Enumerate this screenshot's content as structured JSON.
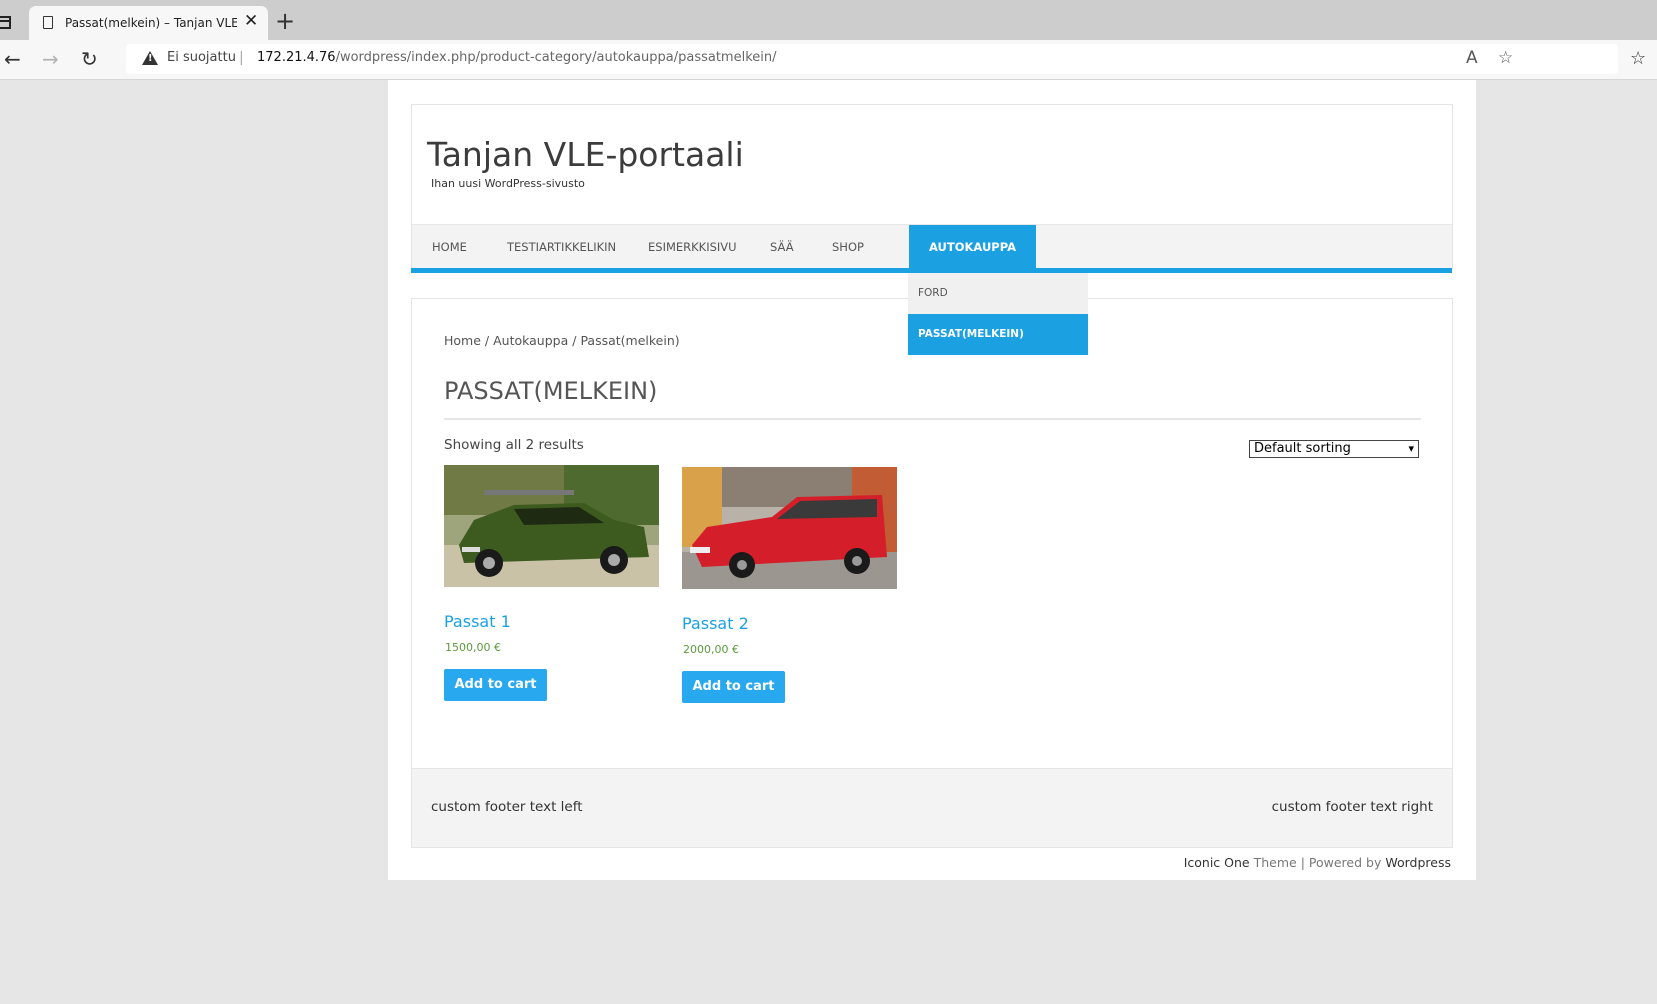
{
  "browser": {
    "tab_title": "Passat(melkein) – Tanjan VLE-portaali",
    "security_label": "Ei suojattu",
    "url_host": "172.21.4.76",
    "url_path": "/wordpress/index.php/product-category/autokauppa/passatmelkein/"
  },
  "site": {
    "title": "Tanjan VLE-portaali",
    "description": "Ihan uusi WordPress-sivusto"
  },
  "menu": {
    "items": [
      "HOME",
      "TESTIARTIKKELIKIN",
      "ESIMERKKISIVU",
      "SÄÄ",
      "SHOP",
      "AUTOKAUPPA"
    ],
    "submenu": [
      "FORD",
      "PASSAT(MELKEIN)"
    ]
  },
  "breadcrumb": {
    "home": "Home",
    "category": "Autokauppa",
    "current": "Passat(melkein)",
    "separator": "/"
  },
  "page_title": "PASSAT(MELKEIN)",
  "result_count": "Showing all 2 results",
  "sorting": "Default sorting",
  "products": [
    {
      "name": "Passat 1",
      "price": "1500,00 €",
      "button": "Add to cart"
    },
    {
      "name": "Passat 2",
      "price": "2000,00 €",
      "button": "Add to cart"
    }
  ],
  "footer": {
    "left": "custom footer text left",
    "right": "custom footer text right"
  },
  "credits": {
    "theme_name": "Iconic One",
    "theme_word": "Theme",
    "separator": "|",
    "powered_by": "Powered by",
    "platform": "Wordpress"
  },
  "colors": {
    "accent": "#1ba1e2",
    "button": "#28a8ee",
    "price": "#5a9b3d"
  }
}
